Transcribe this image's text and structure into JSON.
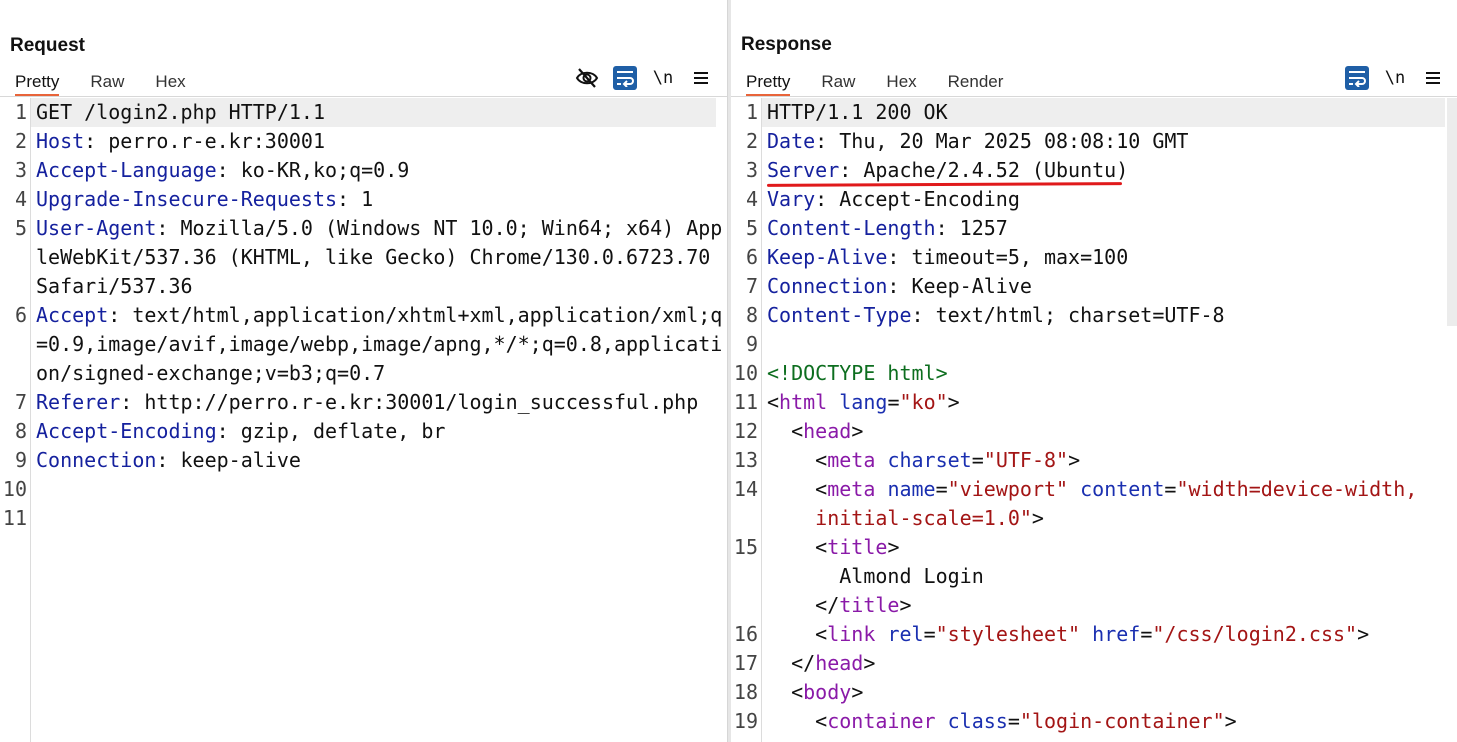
{
  "request": {
    "title": "Request",
    "tabs": [
      "Pretty",
      "Raw",
      "Hex"
    ],
    "active_tab": "Pretty",
    "toolbar_icons": [
      "eye-off-icon",
      "wrap-icon",
      "newline-icon",
      "menu-icon"
    ],
    "newline_label": "\\n",
    "lines": [
      {
        "n": "1",
        "code": "GET /login2.php HTTP/1.1"
      },
      {
        "n": "2",
        "key": "Host",
        "val": ": perro.r-e.kr:30001"
      },
      {
        "n": "3",
        "key": "Accept-Language",
        "val": ": ko-KR,ko;q=0.9"
      },
      {
        "n": "4",
        "key": "Upgrade-Insecure-Requests",
        "val": ": 1"
      },
      {
        "n": "5",
        "key": "User-Agent",
        "val": ": Mozilla/5.0 (Windows NT 10.0; Win64; x64) AppleWebKit/537.36 (KHTML, like Gecko) Chrome/130.0.6723.70 Safari/537.36"
      },
      {
        "n": "6",
        "key": "Accept",
        "val": ": text/html,application/xhtml+xml,application/xml;q=0.9,image/avif,image/webp,image/apng,*/*;q=0.8,application/signed-exchange;v=b3;q=0.7"
      },
      {
        "n": "7",
        "key": "Referer",
        "val": ": http://perro.r-e.kr:30001/login_successful.php"
      },
      {
        "n": "8",
        "key": "Accept-Encoding",
        "val": ": gzip, deflate, br"
      },
      {
        "n": "9",
        "key": "Connection",
        "val": ": keep-alive"
      },
      {
        "n": "10",
        "code": ""
      },
      {
        "n": "11",
        "code": ""
      }
    ]
  },
  "response": {
    "title": "Response",
    "tabs": [
      "Pretty",
      "Raw",
      "Hex",
      "Render"
    ],
    "active_tab": "Pretty",
    "toolbar_icons": [
      "wrap-icon",
      "newline-icon",
      "menu-icon"
    ],
    "newline_label": "\\n",
    "highlighted_line": "3",
    "headers": [
      {
        "n": "1",
        "code": "HTTP/1.1 200 OK"
      },
      {
        "n": "2",
        "key": "Date",
        "val": ": Thu, 20 Mar 2025 08:08:10 GMT"
      },
      {
        "n": "3",
        "key": "Server",
        "val": ": Apache/2.4.52 (Ubuntu)"
      },
      {
        "n": "4",
        "key": "Vary",
        "val": ": Accept-Encoding"
      },
      {
        "n": "5",
        "key": "Content-Length",
        "val": ": 1257"
      },
      {
        "n": "6",
        "key": "Keep-Alive",
        "val": ": timeout=5, max=100"
      },
      {
        "n": "7",
        "key": "Connection",
        "val": ": Keep-Alive"
      },
      {
        "n": "8",
        "key": "Content-Type",
        "val": ": text/html; charset=UTF-8"
      },
      {
        "n": "9",
        "code": ""
      }
    ],
    "html_lines": {
      "doctype": "<!DOCTYPE html>",
      "html_open": {
        "tag": "html",
        "attr": "lang",
        "value": "\"ko\""
      },
      "head_open": "head",
      "meta_charset": {
        "tag": "meta",
        "attr": "charset",
        "value": "\"UTF-8\""
      },
      "meta_viewport": {
        "tag": "meta",
        "attr1": "name",
        "value1": "\"viewport\"",
        "attr2": "content",
        "value2a": "\"width=device-width,",
        "value2b": "initial-scale=1.0\""
      },
      "title_open": "title",
      "title_text": "Almond Login",
      "title_close": "title",
      "link": {
        "tag": "link",
        "attr1": "rel",
        "value1": "\"stylesheet\"",
        "attr2": "href",
        "value2": "\"/css/login2.css\""
      },
      "head_close": "head",
      "body_open": "body",
      "container": {
        "tag": "container",
        "attr": "class",
        "value": "\"login-container\""
      }
    },
    "html_line_numbers": [
      "10",
      "11",
      "12",
      "13",
      "14",
      "15",
      "16",
      "17",
      "18",
      "19"
    ]
  },
  "layout_switch": [
    "split-vertical-icon",
    "split-horizontal-icon",
    "tabs-icon"
  ],
  "colors": {
    "accent": "#1f5fa6",
    "tab_underline": "#e8643a",
    "annotation": "#e0191b",
    "header_key": "#15219e",
    "tag": "#8a1aa8",
    "attr": "#1a2fb0",
    "value": "#a31515"
  }
}
